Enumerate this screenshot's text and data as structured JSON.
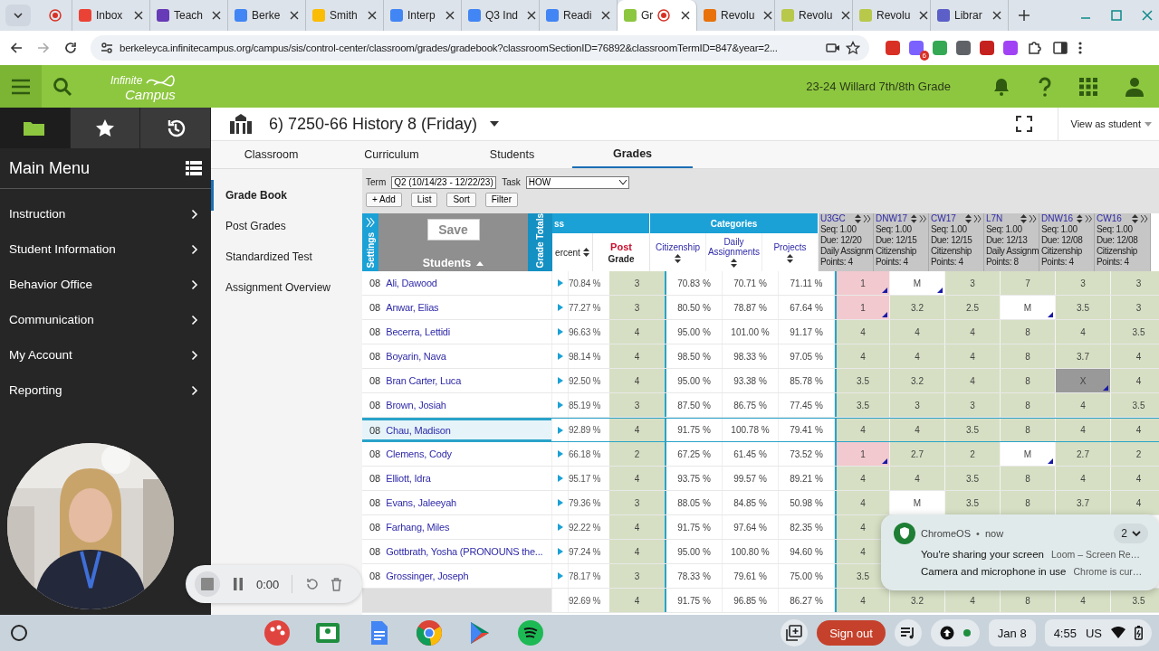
{
  "browser": {
    "tabs": [
      {
        "kind": "pinned",
        "selected": false,
        "recording": true,
        "color": "#d93025"
      },
      {
        "kind": "site",
        "title": "Inbox",
        "selected": false,
        "recording": false,
        "color": "#ea4335"
      },
      {
        "kind": "site",
        "title": "Teach",
        "selected": false,
        "recording": false,
        "color": "#673ab7"
      },
      {
        "kind": "site",
        "title": "Berke",
        "selected": false,
        "recording": false,
        "color": "#4285f4"
      },
      {
        "kind": "site",
        "title": "Smith",
        "selected": false,
        "recording": false,
        "color": "#fbbc04"
      },
      {
        "kind": "site",
        "title": "Interp",
        "selected": false,
        "recording": false,
        "color": "#4285f4"
      },
      {
        "kind": "site",
        "title": "Q3 Ind",
        "selected": false,
        "recording": false,
        "color": "#4285f4"
      },
      {
        "kind": "site",
        "title": "Readi",
        "selected": false,
        "recording": false,
        "color": "#4285f4"
      },
      {
        "kind": "site",
        "title": "Gr",
        "selected": true,
        "recording": true,
        "color": "#8dc63f"
      },
      {
        "kind": "site",
        "title": "Revolu",
        "selected": false,
        "recording": false,
        "color": "#e8710a"
      },
      {
        "kind": "site",
        "title": "Revolu",
        "selected": false,
        "recording": false,
        "color": "#b8c84a"
      },
      {
        "kind": "site",
        "title": "Revolu",
        "selected": false,
        "recording": false,
        "color": "#b8c84a"
      },
      {
        "kind": "site",
        "title": "Librar",
        "selected": false,
        "recording": false,
        "color": "#5b5fc7"
      }
    ],
    "url": "berkeleyca.infinitecampus.org/campus/sis/control-center/classroom/grades/gradebook?classroomSectionID=76892&classroomTermID=847&year=2...",
    "extension_badge": "6"
  },
  "app": {
    "logo": [
      "Infinite",
      "Campus"
    ],
    "school": "23-24 Willard 7th/8th Grade",
    "sidebar": {
      "tabs": [
        {
          "selected": true
        },
        {
          "selected": false
        },
        {
          "selected": false
        }
      ],
      "title": "Main Menu",
      "items": [
        "Instruction",
        "Student Information",
        "Behavior Office",
        "Communication",
        "My Account",
        "Reporting"
      ]
    },
    "section": {
      "title": "6) 7250-66 History 8 (Friday)",
      "view_as": "View as student"
    },
    "tabs": [
      {
        "label": "Classroom",
        "selected": false
      },
      {
        "label": "Curriculum",
        "selected": false
      },
      {
        "label": "Students",
        "selected": false
      },
      {
        "label": "Grades",
        "selected": true
      }
    ],
    "subnav": [
      {
        "label": "Grade Book",
        "selected": true
      },
      {
        "label": "Post Grades",
        "selected": false
      },
      {
        "label": "Standardized Test",
        "selected": false
      },
      {
        "label": "Assignment Overview",
        "selected": false
      }
    ],
    "gradebook": {
      "term_label": "Term",
      "term": "Q2 (10/14/23 - 12/22/23)",
      "task_label": "Task",
      "task": "HOW",
      "buttons": [
        "+ Add",
        "List",
        "Sort",
        "Filter"
      ],
      "settings_label": "Settings",
      "save": "Save",
      "students_label": "Students",
      "grade_totals_label": "Grade Totals",
      "totals_group": "ss",
      "categories_group": "Categories",
      "percent_header": "ercent",
      "post_header": [
        "Post",
        "Grade"
      ],
      "category_columns": [
        "Citizenship",
        "Daily Assignments",
        "Projects"
      ],
      "assignments": [
        {
          "code": "U3GC",
          "seq": "Seq: 1.00",
          "due": "Due: 12/20",
          "category": "Daily Assignm",
          "points": "Points: 4"
        },
        {
          "code": "DNW17",
          "seq": "Seq: 1.00",
          "due": "Due: 12/15",
          "category": "Citizenship",
          "points": "Points: 4"
        },
        {
          "code": "CW17",
          "seq": "Seq: 1.00",
          "due": "Due: 12/15",
          "category": "Citizenship",
          "points": "Points: 4"
        },
        {
          "code": "L7N",
          "seq": "Seq: 1.00",
          "due": "Due: 12/13",
          "category": "Daily Assignm",
          "points": "Points: 8"
        },
        {
          "code": "DNW16",
          "seq": "Seq: 1.00",
          "due": "Due: 12/08",
          "category": "Citizenship",
          "points": "Points: 4"
        },
        {
          "code": "CW16",
          "seq": "Seq: 1.00",
          "due": "Due: 12/08",
          "category": "Citizenship",
          "points": "Points: 4"
        }
      ],
      "rows": [
        {
          "grade": "08",
          "name": "Ali, Dawood",
          "selected": false,
          "percent": "70.84 %",
          "post": "3",
          "categories": [
            "70.83 %",
            "70.71 %",
            "71.11 %"
          ],
          "scores": [
            {
              "value": "1",
              "color": "#f2c9ce",
              "comment": true
            },
            {
              "value": "M",
              "color": "#ffffff",
              "comment": true
            },
            {
              "value": "3",
              "color": "#d6dfc3",
              "comment": false
            },
            {
              "value": "7",
              "color": "#d6dfc3",
              "comment": false
            },
            {
              "value": "3",
              "color": "#d6dfc3",
              "comment": false
            },
            {
              "value": "3",
              "color": "#d6dfc3",
              "comment": false
            }
          ]
        },
        {
          "grade": "08",
          "name": "Anwar, Elias",
          "selected": false,
          "percent": "77.27 %",
          "post": "3",
          "categories": [
            "80.50 %",
            "78.87 %",
            "67.64 %"
          ],
          "scores": [
            {
              "value": "1",
              "color": "#f2c9ce",
              "comment": true
            },
            {
              "value": "3.2",
              "color": "#d6dfc3",
              "comment": false
            },
            {
              "value": "2.5",
              "color": "#d6dfc3",
              "comment": false
            },
            {
              "value": "M",
              "color": "#ffffff",
              "comment": true
            },
            {
              "value": "3.5",
              "color": "#d6dfc3",
              "comment": false
            },
            {
              "value": "3",
              "color": "#d6dfc3",
              "comment": false
            }
          ]
        },
        {
          "grade": "08",
          "name": "Becerra, Lettidi",
          "selected": false,
          "percent": "96.63 %",
          "post": "4",
          "categories": [
            "95.00 %",
            "101.00 %",
            "91.17 %"
          ],
          "scores": [
            {
              "value": "4",
              "color": "#d6dfc3",
              "comment": false
            },
            {
              "value": "4",
              "color": "#d6dfc3",
              "comment": false
            },
            {
              "value": "4",
              "color": "#d6dfc3",
              "comment": false
            },
            {
              "value": "8",
              "color": "#d6dfc3",
              "comment": false
            },
            {
              "value": "4",
              "color": "#d6dfc3",
              "comment": false
            },
            {
              "value": "3.5",
              "color": "#d6dfc3",
              "comment": false
            }
          ]
        },
        {
          "grade": "08",
          "name": "Boyarin, Nava",
          "selected": false,
          "percent": "98.14 %",
          "post": "4",
          "categories": [
            "98.50 %",
            "98.33 %",
            "97.05 %"
          ],
          "scores": [
            {
              "value": "4",
              "color": "#d6dfc3",
              "comment": false
            },
            {
              "value": "4",
              "color": "#d6dfc3",
              "comment": false
            },
            {
              "value": "4",
              "color": "#d6dfc3",
              "comment": false
            },
            {
              "value": "8",
              "color": "#d6dfc3",
              "comment": false
            },
            {
              "value": "3.7",
              "color": "#d6dfc3",
              "comment": false
            },
            {
              "value": "4",
              "color": "#d6dfc3",
              "comment": false
            }
          ]
        },
        {
          "grade": "08",
          "name": "Bran Carter, Luca",
          "selected": false,
          "percent": "92.50 %",
          "post": "4",
          "categories": [
            "95.00 %",
            "93.38 %",
            "85.78 %"
          ],
          "scores": [
            {
              "value": "3.5",
              "color": "#d6dfc3",
              "comment": false
            },
            {
              "value": "3.2",
              "color": "#d6dfc3",
              "comment": false
            },
            {
              "value": "4",
              "color": "#d6dfc3",
              "comment": false
            },
            {
              "value": "8",
              "color": "#d6dfc3",
              "comment": false
            },
            {
              "value": "X",
              "color": "#999999",
              "comment": true
            },
            {
              "value": "4",
              "color": "#d6dfc3",
              "comment": false
            }
          ]
        },
        {
          "grade": "08",
          "name": "Brown, Josiah",
          "selected": false,
          "percent": "85.19 %",
          "post": "3",
          "categories": [
            "87.50 %",
            "86.75 %",
            "77.45 %"
          ],
          "scores": [
            {
              "value": "3.5",
              "color": "#d6dfc3",
              "comment": false
            },
            {
              "value": "3",
              "color": "#d6dfc3",
              "comment": false
            },
            {
              "value": "3",
              "color": "#d6dfc3",
              "comment": false
            },
            {
              "value": "8",
              "color": "#d6dfc3",
              "comment": false
            },
            {
              "value": "4",
              "color": "#d6dfc3",
              "comment": false
            },
            {
              "value": "3.5",
              "color": "#d6dfc3",
              "comment": false
            }
          ]
        },
        {
          "grade": "08",
          "name": "Chau, Madison",
          "selected": true,
          "percent": "92.89 %",
          "post": "4",
          "categories": [
            "91.75 %",
            "100.78 %",
            "79.41 %"
          ],
          "scores": [
            {
              "value": "4",
              "color": "#d6dfc3",
              "comment": false
            },
            {
              "value": "4",
              "color": "#d6dfc3",
              "comment": false
            },
            {
              "value": "3.5",
              "color": "#d6dfc3",
              "comment": false
            },
            {
              "value": "8",
              "color": "#d6dfc3",
              "comment": false
            },
            {
              "value": "4",
              "color": "#d6dfc3",
              "comment": false
            },
            {
              "value": "4",
              "color": "#d6dfc3",
              "comment": false
            }
          ]
        },
        {
          "grade": "08",
          "name": "Clemens, Cody",
          "selected": false,
          "percent": "66.18 %",
          "post": "2",
          "categories": [
            "67.25 %",
            "61.45 %",
            "73.52 %"
          ],
          "scores": [
            {
              "value": "1",
              "color": "#f2c9ce",
              "comment": true
            },
            {
              "value": "2.7",
              "color": "#d6dfc3",
              "comment": false
            },
            {
              "value": "2",
              "color": "#d6dfc3",
              "comment": false
            },
            {
              "value": "M",
              "color": "#ffffff",
              "comment": true
            },
            {
              "value": "2.7",
              "color": "#d6dfc3",
              "comment": false
            },
            {
              "value": "2",
              "color": "#d6dfc3",
              "comment": false
            }
          ]
        },
        {
          "grade": "08",
          "name": "Elliott, Idra",
          "selected": false,
          "percent": "95.17 %",
          "post": "4",
          "categories": [
            "93.75 %",
            "99.57 %",
            "89.21 %"
          ],
          "scores": [
            {
              "value": "4",
              "color": "#d6dfc3",
              "comment": false
            },
            {
              "value": "4",
              "color": "#d6dfc3",
              "comment": false
            },
            {
              "value": "3.5",
              "color": "#d6dfc3",
              "comment": false
            },
            {
              "value": "8",
              "color": "#d6dfc3",
              "comment": false
            },
            {
              "value": "4",
              "color": "#d6dfc3",
              "comment": false
            },
            {
              "value": "4",
              "color": "#d6dfc3",
              "comment": false
            }
          ]
        },
        {
          "grade": "08",
          "name": "Evans, Jaleeyah",
          "selected": false,
          "percent": "79.36 %",
          "post": "3",
          "categories": [
            "88.05 %",
            "84.85 %",
            "50.98 %"
          ],
          "scores": [
            {
              "value": "4",
              "color": "#d6dfc3",
              "comment": false
            },
            {
              "value": "M",
              "color": "#ffffff",
              "comment": false
            },
            {
              "value": "3.5",
              "color": "#d6dfc3",
              "comment": false
            },
            {
              "value": "8",
              "color": "#d6dfc3",
              "comment": false
            },
            {
              "value": "3.7",
              "color": "#d6dfc3",
              "comment": false
            },
            {
              "value": "4",
              "color": "#d6dfc3",
              "comment": false
            }
          ]
        },
        {
          "grade": "08",
          "name": "Farhang, Miles",
          "selected": false,
          "percent": "92.22 %",
          "post": "4",
          "categories": [
            "91.75 %",
            "97.64 %",
            "82.35 %"
          ],
          "scores": [
            {
              "value": "4",
              "color": "#d6dfc3",
              "comment": false
            }
          ]
        },
        {
          "grade": "08",
          "name": "Gottbrath, Yosha (PRONOUNS the...",
          "selected": false,
          "percent": "97.24 %",
          "post": "4",
          "categories": [
            "95.00 %",
            "100.80 %",
            "94.60 %"
          ],
          "scores": [
            {
              "value": "4",
              "color": "#d6dfc3",
              "comment": false
            }
          ]
        },
        {
          "grade": "08",
          "name": "Grossinger, Joseph",
          "selected": false,
          "percent": "78.17 %",
          "post": "3",
          "categories": [
            "78.33 %",
            "79.61 %",
            "75.00 %"
          ],
          "scores": [
            {
              "value": "3.5",
              "color": "#d6dfc3",
              "comment": false
            }
          ]
        },
        {
          "selected": false,
          "percent": "92.69 %",
          "post": "4",
          "categories": [
            "91.75 %",
            "96.85 %",
            "86.27 %"
          ],
          "scores": [
            {
              "value": "4",
              "color": "#d6dfc3",
              "comment": false
            },
            {
              "value": "3.2",
              "color": "#d6dfc3",
              "comment": false
            },
            {
              "value": "4",
              "color": "#d6dfc3",
              "comment": false
            },
            {
              "value": "8",
              "color": "#d6dfc3",
              "comment": false
            },
            {
              "value": "4",
              "color": "#d6dfc3",
              "comment": false
            },
            {
              "value": "3.5",
              "color": "#d6dfc3",
              "comment": false
            }
          ]
        }
      ]
    }
  },
  "recorder": {
    "time": "0:00"
  },
  "notification": {
    "app": "ChromeOS",
    "separator": "•",
    "time": "now",
    "count": "2",
    "lines": [
      {
        "title": "You're sharing your screen",
        "detail": "Loom – Screen Re…"
      },
      {
        "title": "Camera and microphone in use",
        "detail": "Chrome is cur…"
      }
    ]
  },
  "shelf": {
    "sign_out": "Sign out",
    "date": "Jan 8",
    "time": "4:55",
    "locale": "US"
  }
}
